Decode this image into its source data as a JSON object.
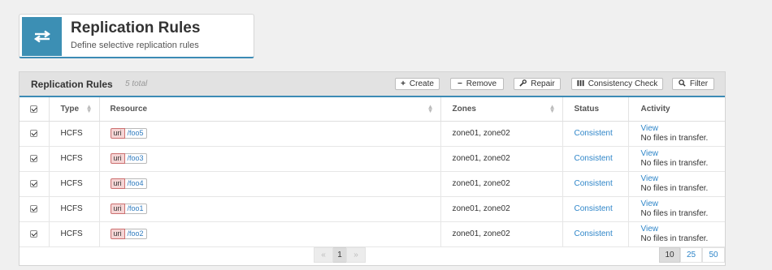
{
  "header": {
    "title": "Replication Rules",
    "subtitle": "Define selective replication rules"
  },
  "panel": {
    "title": "Replication Rules",
    "count": "5 total"
  },
  "toolbar": {
    "create": {
      "icon": "+",
      "label": "Create"
    },
    "remove": {
      "icon": "−",
      "label": "Remove"
    },
    "repair": {
      "icon": "wrench-icon",
      "label": "Repair"
    },
    "consistency": {
      "icon": "columns-icon",
      "label": "Consistency Check"
    },
    "filter": {
      "icon": "search-icon",
      "label": "Filter"
    }
  },
  "columns": {
    "type": "Type",
    "resource": "Resource",
    "zones": "Zones",
    "status": "Status",
    "activity": "Activity"
  },
  "rows": [
    {
      "checked": true,
      "type": "HCFS",
      "tag": "uri",
      "path": "/foo5",
      "zones": "zone01, zone02",
      "status": "Consistent",
      "view": "View",
      "activity": "No files in transfer."
    },
    {
      "checked": true,
      "type": "HCFS",
      "tag": "uri",
      "path": "/foo3",
      "zones": "zone01, zone02",
      "status": "Consistent",
      "view": "View",
      "activity": "No files in transfer."
    },
    {
      "checked": true,
      "type": "HCFS",
      "tag": "uri",
      "path": "/foo4",
      "zones": "zone01, zone02",
      "status": "Consistent",
      "view": "View",
      "activity": "No files in transfer."
    },
    {
      "checked": true,
      "type": "HCFS",
      "tag": "uri",
      "path": "/foo1",
      "zones": "zone01, zone02",
      "status": "Consistent",
      "view": "View",
      "activity": "No files in transfer."
    },
    {
      "checked": true,
      "type": "HCFS",
      "tag": "uri",
      "path": "/foo2",
      "zones": "zone01, zone02",
      "status": "Consistent",
      "view": "View",
      "activity": "No files in transfer."
    }
  ],
  "pagination": {
    "prev": "«",
    "current": "1",
    "next": "»",
    "page_sizes": [
      "10",
      "25",
      "50"
    ],
    "selected_size": "10"
  },
  "colors": {
    "accent": "#3c8bb5",
    "link": "#2f86c9",
    "uri_tag_bg": "#f5d5d5"
  }
}
